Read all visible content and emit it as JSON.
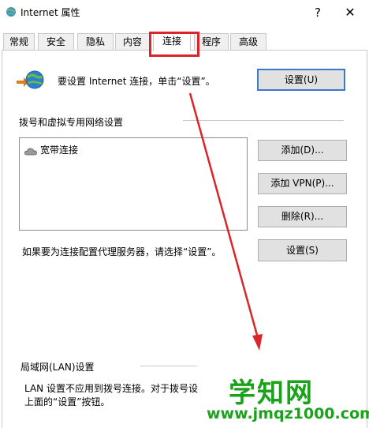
{
  "window": {
    "title": "Internet 属性",
    "help": "?",
    "close": "✕"
  },
  "tabs": [
    {
      "label": "常规"
    },
    {
      "label": "安全"
    },
    {
      "label": "隐私"
    },
    {
      "label": "内容"
    },
    {
      "label": "连接",
      "active": true
    },
    {
      "label": "程序"
    },
    {
      "label": "高级"
    }
  ],
  "setup": {
    "text": "要设置 Internet 连接，单击“设置”。",
    "button": "设置(U)"
  },
  "dialup": {
    "heading": "拨号和虚拟专用网络设置",
    "connections": [
      "宽带连接"
    ],
    "add_button": "添加(D)...",
    "add_vpn_button": "添加 VPN(P)...",
    "remove_button": "删除(R)...",
    "proxy_text": "如果要为连接配置代理服务器，请选择“设置”。",
    "settings_button": "设置(S)"
  },
  "lan": {
    "heading": "局域网(LAN)设置",
    "text_line1": "LAN 设置不应用到拨号连接。对于拨号设",
    "text_line2": "上面的“设置”按钮。"
  },
  "watermark": {
    "logo": "学知网",
    "url": "www.jmqz1000.com"
  },
  "colors": {
    "highlight_red": "#d9262b",
    "watermark_green": "#1aa21a",
    "default_button_border": "#3b79c9"
  }
}
